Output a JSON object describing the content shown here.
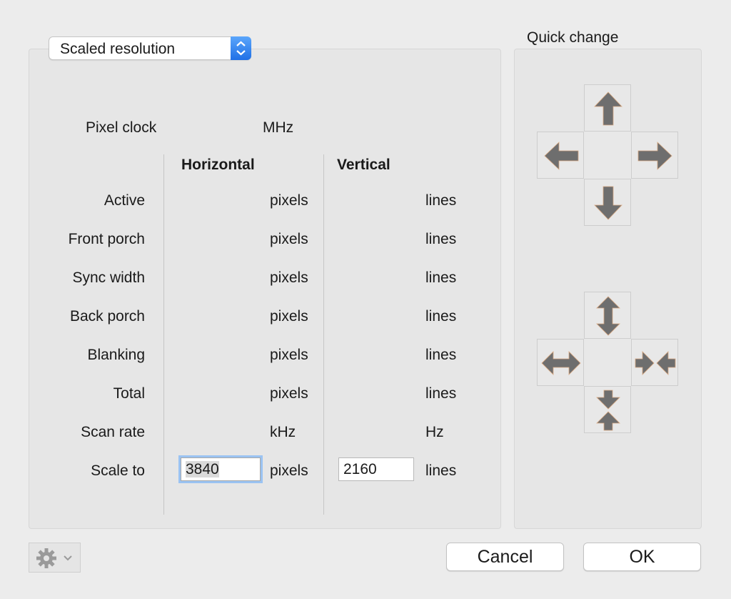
{
  "mode_popup": {
    "selected": "Scaled resolution"
  },
  "quick_change": {
    "title": "Quick change"
  },
  "pixel_clock": {
    "label": "Pixel clock",
    "unit": "MHz"
  },
  "columns": {
    "horizontal": "Horizontal",
    "vertical": "Vertical"
  },
  "rows": [
    {
      "label": "Active",
      "h_unit": "pixels",
      "v_unit": "lines"
    },
    {
      "label": "Front porch",
      "h_unit": "pixels",
      "v_unit": "lines"
    },
    {
      "label": "Sync width",
      "h_unit": "pixels",
      "v_unit": "lines"
    },
    {
      "label": "Back porch",
      "h_unit": "pixels",
      "v_unit": "lines"
    },
    {
      "label": "Blanking",
      "h_unit": "pixels",
      "v_unit": "lines"
    },
    {
      "label": "Total",
      "h_unit": "pixels",
      "v_unit": "lines"
    },
    {
      "label": "Scan rate",
      "h_unit": "kHz",
      "v_unit": "Hz"
    },
    {
      "label": "Scale to",
      "h_unit": "pixels",
      "v_unit": "lines"
    }
  ],
  "scale_to": {
    "horizontal_value": "3840",
    "vertical_value": "2160"
  },
  "buttons": {
    "cancel": "Cancel",
    "ok": "OK"
  },
  "icons": {
    "move": [
      "arrow-up-icon",
      "arrow-left-icon",
      "arrow-right-icon",
      "arrow-down-icon"
    ],
    "resize": [
      "expand-vertical-icon",
      "expand-horizontal-icon",
      "shrink-horizontal-icon",
      "shrink-vertical-icon"
    ],
    "settings": "gear-icon"
  },
  "colors": {
    "accent": "#1f70e6",
    "focus_ring": "#9bc3f2",
    "arrow": "#6e6e6e"
  }
}
